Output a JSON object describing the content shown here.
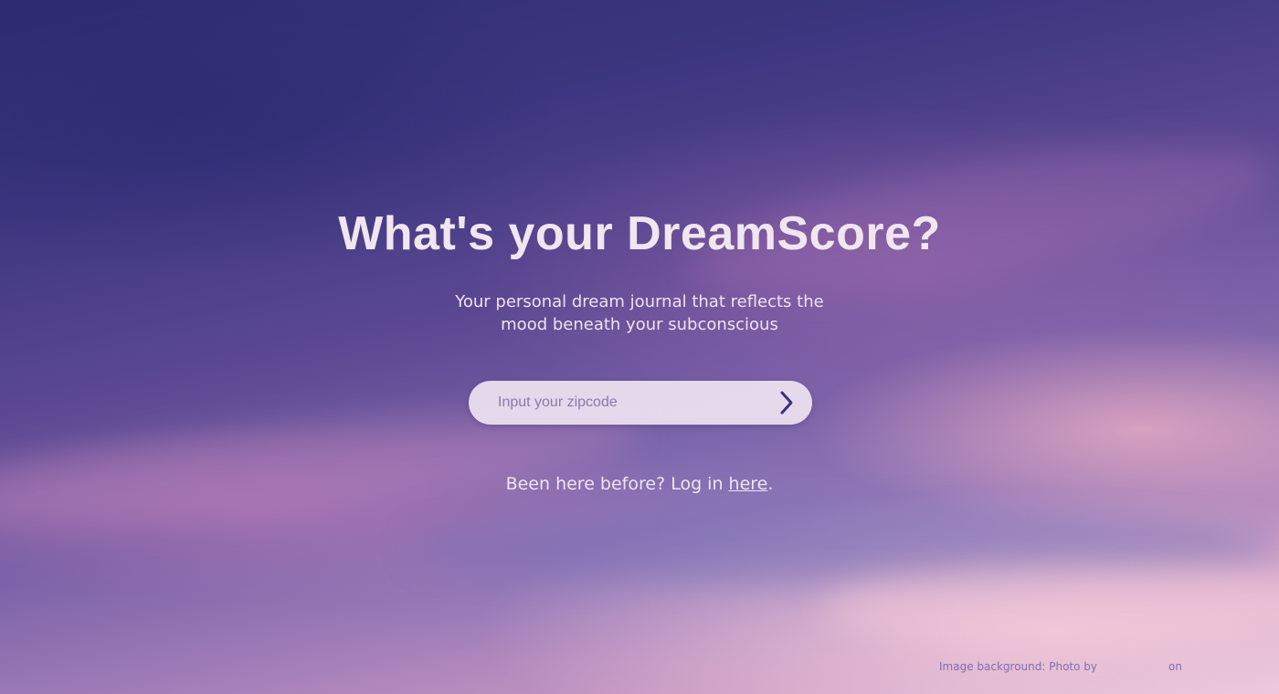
{
  "hero": {
    "title": "What's your DreamScore?",
    "subtitle_line1": "Your personal dream journal that reflects the",
    "subtitle_line2": "mood beneath your subconscious"
  },
  "zip_form": {
    "placeholder": "Input your zipcode",
    "value": "",
    "submit_icon": "chevron-right-icon"
  },
  "login": {
    "prefix": "Been here before? Log in ",
    "link_label": "here",
    "suffix": "."
  },
  "footer": {
    "credit_prefix": "Image background: Photo by",
    "credit_suffix": "on"
  },
  "colors": {
    "accent": "#3a2f7a",
    "text": "#f0e6ef"
  }
}
